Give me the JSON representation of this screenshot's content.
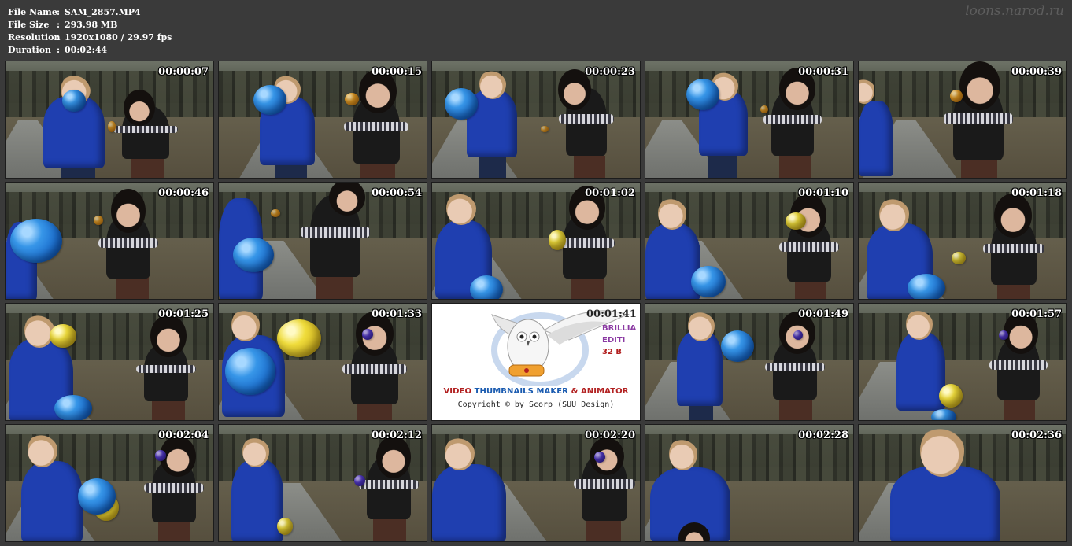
{
  "info": {
    "rows": [
      {
        "key": "File Name",
        "sep": ":",
        "value": "SAM_2857.MP4"
      },
      {
        "key": "File Size",
        "sep": ":",
        "value": "293.98 MB"
      },
      {
        "key": "Resolution",
        "sep": ":",
        "value": "1920x1080 / 29.97 fps"
      },
      {
        "key": "Duration",
        "sep": ":",
        "value": "00:02:44"
      }
    ]
  },
  "watermark": "loons.narod.ru",
  "thumbnails": [
    {
      "time": "00:00:07"
    },
    {
      "time": "00:00:15"
    },
    {
      "time": "00:00:23"
    },
    {
      "time": "00:00:31"
    },
    {
      "time": "00:00:39"
    },
    {
      "time": "00:00:46"
    },
    {
      "time": "00:00:54"
    },
    {
      "time": "00:01:02"
    },
    {
      "time": "00:01:10"
    },
    {
      "time": "00:01:18"
    },
    {
      "time": "00:01:25"
    },
    {
      "time": "00:01:33"
    },
    {
      "time": "00:01:41"
    },
    {
      "time": "00:01:49"
    },
    {
      "time": "00:01:57"
    },
    {
      "time": "00:02:04"
    },
    {
      "time": "00:02:12"
    },
    {
      "time": "00:02:20"
    },
    {
      "time": "00:02:28"
    },
    {
      "time": "00:02:36"
    }
  ],
  "logo": {
    "title_part1": "VIDEO ",
    "title_part2": "THUMBNAILS MAKER",
    "title_part3": " & ANIMATOR",
    "copyright": "Copyright © by Scorp (SUU Design)",
    "edition_line1": "BRILLIA",
    "edition_line2": "EDITI",
    "edition_line3": "32 B",
    "overlay_time": "00:01:41"
  },
  "colors": {
    "background": "#3a3a3a",
    "jacket_blue": "#1f3fb0",
    "timestamp_text": "#ffffff"
  }
}
